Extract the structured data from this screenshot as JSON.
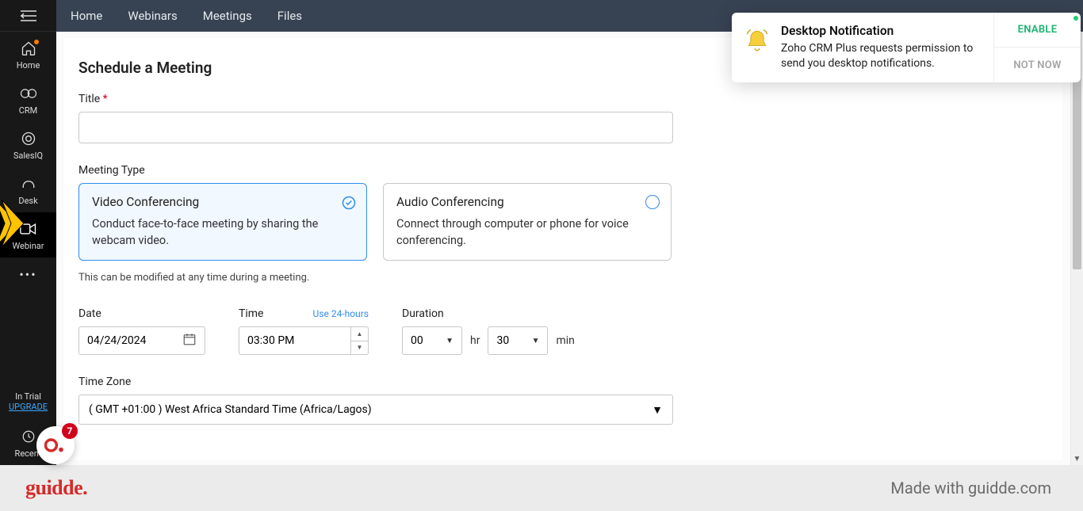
{
  "topnav": {
    "items": [
      "Home",
      "Webinars",
      "Meetings",
      "Files"
    ]
  },
  "sidebar": {
    "items": [
      {
        "label": "Home"
      },
      {
        "label": "CRM"
      },
      {
        "label": "SalesIQ"
      },
      {
        "label": "Desk"
      },
      {
        "label": "Webinar"
      },
      {
        "label": "•••"
      }
    ],
    "trial": {
      "line1": "In Trial",
      "upgrade": "UPGRADE",
      "recent": "Recent"
    }
  },
  "page": {
    "title": "Schedule a Meeting",
    "title_field_label": "Title",
    "meeting_type_label": "Meeting Type",
    "types": [
      {
        "title": "Video Conferencing",
        "desc": "Conduct face-to-face meeting by sharing the webcam video."
      },
      {
        "title": "Audio Conferencing",
        "desc": "Connect through computer or phone for voice conferencing."
      }
    ],
    "hint": "This can be modified at any time during a meeting.",
    "date_label": "Date",
    "date_value": "04/24/2024",
    "time_label": "Time",
    "time_link": "Use 24-hours",
    "time_value": "03:30 PM",
    "duration_label": "Duration",
    "duration_hr": "00",
    "hr_unit": "hr",
    "duration_min": "30",
    "min_unit": "min",
    "tz_label": "Time Zone",
    "tz_value": "( GMT +01:00 ) West Africa Standard Time (Africa/Lagos)"
  },
  "toast": {
    "title": "Desktop Notification",
    "body": "Zoho CRM Plus requests permission to send you desktop notifications.",
    "enable": "ENABLE",
    "notnow": "NOT NOW"
  },
  "badge": {
    "count": "7"
  },
  "footer": {
    "brand": "guidde.",
    "made": "Made with guidde.com"
  }
}
